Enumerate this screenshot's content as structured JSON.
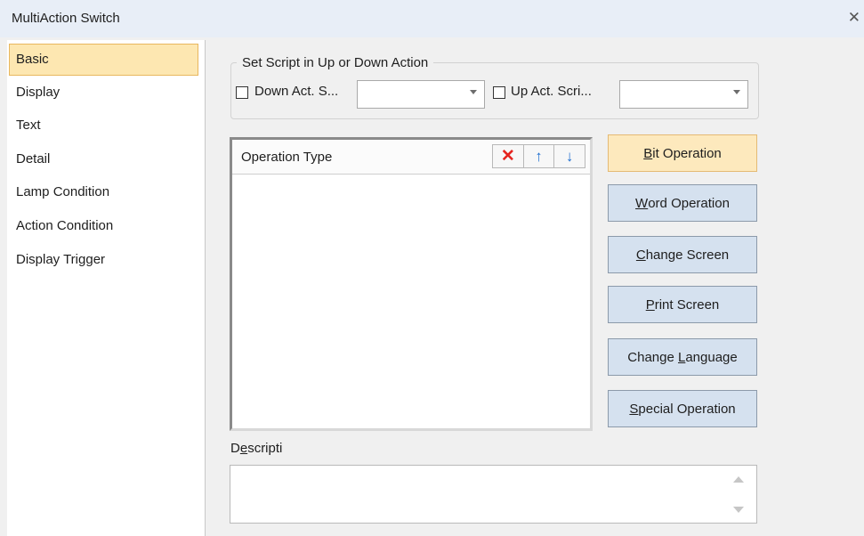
{
  "window": {
    "title": "MultiAction Switch",
    "close_glyph": "✕"
  },
  "sidebar": {
    "items": [
      {
        "label": "Basic",
        "selected": true
      },
      {
        "label": "Display"
      },
      {
        "label": "Text"
      },
      {
        "label": "Detail"
      },
      {
        "label": "Lamp Condition"
      },
      {
        "label": "Action Condition"
      },
      {
        "label": "Display Trigger"
      }
    ]
  },
  "script_group": {
    "legend": "Set Script in Up or Down Action",
    "down_label": "Down Act. S...",
    "down_value": "",
    "down_checked": false,
    "up_label": "Up Act. Scri...",
    "up_value": "",
    "up_checked": false
  },
  "operation_list": {
    "header": "Operation Type",
    "delete_glyph": "✕",
    "up_glyph": "↑",
    "down_glyph": "↓",
    "items": []
  },
  "buttons": {
    "bit": {
      "mnemonic": "B",
      "rest": "it Operation"
    },
    "word": {
      "mnemonic": "W",
      "rest": "ord Operation"
    },
    "change_screen": {
      "mnemonic": "C",
      "rest": "hange Screen"
    },
    "print_screen": {
      "mnemonic": "P",
      "rest": "rint Screen"
    },
    "change_language": {
      "pre": "Change ",
      "mnemonic": "L",
      "rest": "anguage"
    },
    "special": {
      "mnemonic": "S",
      "rest": "pecial Operation"
    }
  },
  "description": {
    "label_pre": "D",
    "label_mnemonic": "e",
    "label_rest": "scripti",
    "value": ""
  },
  "colors": {
    "selected_bg": "#fde7b1",
    "button_bg": "#d5e1ef",
    "delete_red": "#e5241f",
    "arrow_blue": "#1f6fd0"
  }
}
